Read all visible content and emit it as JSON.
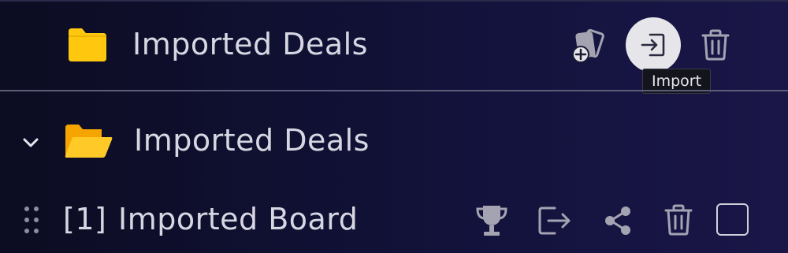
{
  "rows": [
    {
      "folder_name": "Imported Deals"
    },
    {
      "folder_name": "Imported Deals"
    }
  ],
  "board": {
    "index": "[1]",
    "name": "Imported Board"
  },
  "tooltip": {
    "text": "Import"
  },
  "colors": {
    "folder_closed": "#ffc80f",
    "folder_open_back": "#f5a400",
    "folder_open_front": "#ffca28",
    "icon_gray": "#a3a3b2",
    "background": "#0e0e28"
  },
  "icons": {
    "row1": [
      "folder-icon",
      "add-cards-icon",
      "import-icon",
      "trash-icon"
    ],
    "row2": [
      "chevron-down-icon",
      "folder-open-icon"
    ],
    "row3": [
      "drag-handle-icon",
      "trophy-icon",
      "export-icon",
      "share-icon",
      "trash-icon",
      "checkbox"
    ]
  }
}
